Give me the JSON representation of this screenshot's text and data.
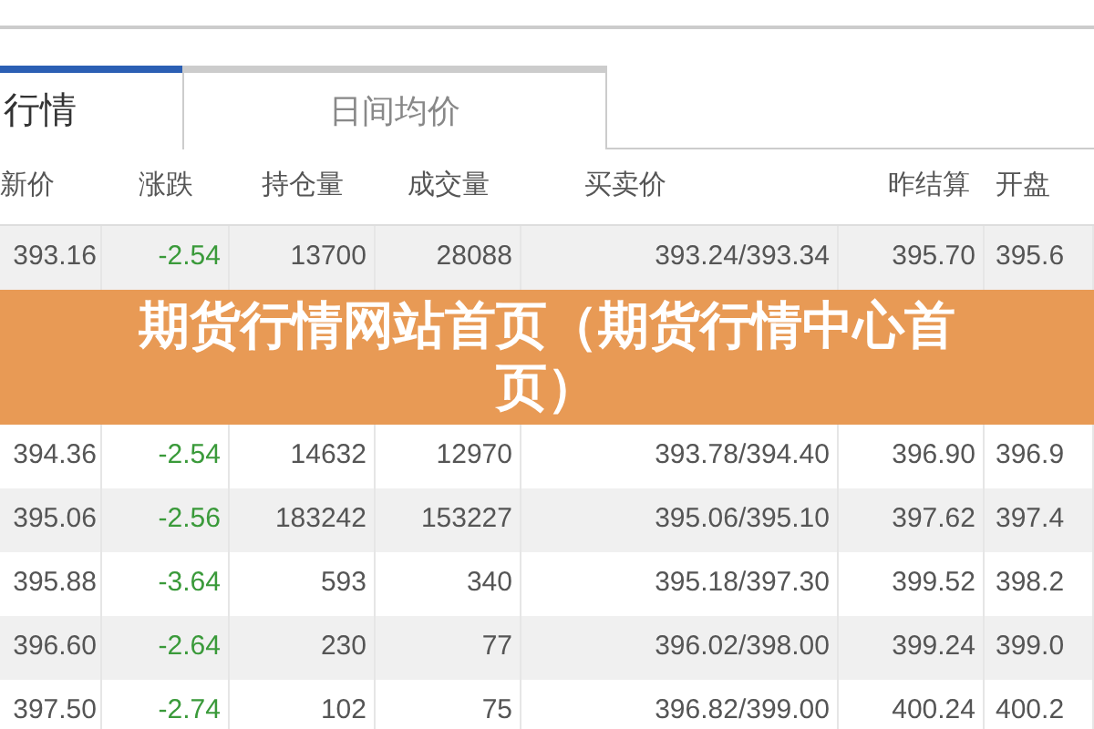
{
  "tabs": [
    {
      "label": "行情",
      "selected": true
    },
    {
      "label": "日间均价",
      "selected": false
    }
  ],
  "table": {
    "columns": [
      "新价",
      "涨跌",
      "持仓量",
      "成交量",
      "买卖价",
      "昨结算",
      "开盘"
    ],
    "rows": [
      [
        "393.16",
        "-2.54",
        "13700",
        "28088",
        "393.24/393.34",
        "395.70",
        "395.6"
      ],
      [
        "394.36",
        "-2.54",
        "14632",
        "12970",
        "393.78/394.40",
        "396.90",
        "396.9"
      ],
      [
        "395.06",
        "-2.56",
        "183242",
        "153227",
        "395.06/395.10",
        "397.62",
        "397.4"
      ],
      [
        "395.88",
        "-3.64",
        "593",
        "340",
        "395.18/397.30",
        "399.52",
        "398.2"
      ],
      [
        "396.60",
        "-2.64",
        "230",
        "77",
        "396.02/398.00",
        "399.24",
        "399.0"
      ],
      [
        "397.50",
        "-2.74",
        "102",
        "75",
        "396.82/399.00",
        "400.24",
        "400.2"
      ]
    ]
  },
  "banner": {
    "title": "期货行情网站首页（期货行情中心首页）"
  }
}
